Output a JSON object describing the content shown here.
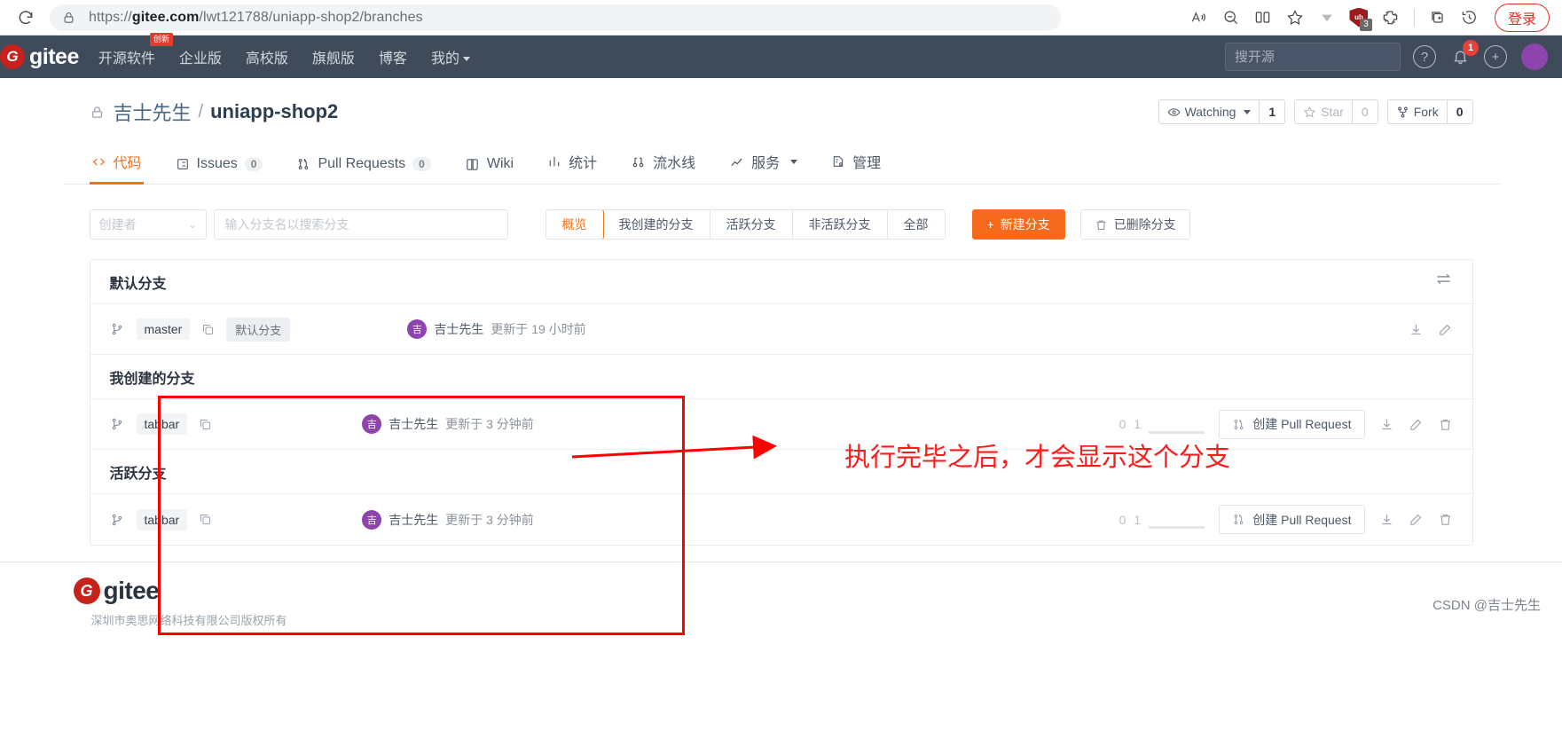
{
  "browser": {
    "reload_icon": "reload-icon",
    "lock_icon": "lock-icon",
    "url_prefix": "https://",
    "url_domain": "gitee.com",
    "url_path": "/lwt121788/uniapp-shop2/branches",
    "icons": [
      {
        "name": "read-aloud-icon",
        "glyph": "A"
      },
      {
        "name": "zoom-out-icon",
        "glyph": "search"
      },
      {
        "name": "split-screen-icon",
        "glyph": "split"
      },
      {
        "name": "favorite-star-icon",
        "glyph": "star"
      },
      {
        "name": "downloads-chevron-icon",
        "glyph": "V"
      },
      {
        "name": "shield-extension-icon",
        "glyph": "ub"
      },
      {
        "name": "puzzle-extension-icon",
        "glyph": "puzzle"
      },
      {
        "name": "collections-icon",
        "glyph": "collections"
      },
      {
        "name": "history-icon",
        "glyph": "history"
      }
    ],
    "shield_badge": "3",
    "login_label": "登录"
  },
  "navbar": {
    "logo": "gitee",
    "logo_mark": "G",
    "links": [
      {
        "label": "开源软件",
        "badge": "创新"
      },
      {
        "label": "企业版",
        "badge": ""
      },
      {
        "label": "高校版",
        "badge": ""
      },
      {
        "label": "旗舰版",
        "badge": ""
      },
      {
        "label": "博客",
        "badge": ""
      },
      {
        "label": "我的",
        "badge": "",
        "has_caret": true
      }
    ],
    "search_placeholder": "搜开源",
    "help_icon": "?",
    "notification_count": "1",
    "plus_icon": "+"
  },
  "repo": {
    "lock_icon": "lock-icon",
    "owner": "吉士先生",
    "separator": "/",
    "name": "uniapp-shop2",
    "watching_label": "Watching",
    "watching_count": "1",
    "star_label": "Star",
    "star_count": "0",
    "fork_label": "Fork",
    "fork_count": "0"
  },
  "tabs": [
    {
      "label": "代码",
      "count": "",
      "icon": "code-icon",
      "active": true
    },
    {
      "label": "Issues",
      "count": "0",
      "icon": "issues-icon",
      "active": false
    },
    {
      "label": "Pull Requests",
      "count": "0",
      "icon": "pull-request-icon",
      "active": false
    },
    {
      "label": "Wiki",
      "count": "",
      "icon": "book-icon",
      "active": false
    },
    {
      "label": "统计",
      "count": "",
      "icon": "chart-icon",
      "active": false
    },
    {
      "label": "流水线",
      "count": "",
      "icon": "pipeline-icon",
      "active": false
    },
    {
      "label": "服务",
      "count": "",
      "icon": "graph-icon",
      "active": false,
      "caret": true
    },
    {
      "label": "管理",
      "count": "",
      "icon": "settings-doc-icon",
      "active": false
    }
  ],
  "toolbar": {
    "creator_select": "创建者",
    "search_placeholder": "输入分支名以搜索分支",
    "filters": [
      {
        "label": "概览",
        "active": true
      },
      {
        "label": "我创建的分支",
        "active": false
      },
      {
        "label": "活跃分支",
        "active": false
      },
      {
        "label": "非活跃分支",
        "active": false
      },
      {
        "label": "全部",
        "active": false
      }
    ],
    "new_branch_label": "新建分支",
    "new_branch_plus": "+",
    "deleted_branch_label": "已删除分支"
  },
  "panels": [
    {
      "title": "默认分支",
      "has_swap": true,
      "rows": [
        {
          "branch": "master",
          "tag": "默认分支",
          "avatar_letter": "吉",
          "author": "吉士先生",
          "update_text": "更新于 19 小时前",
          "ahead": "",
          "behind": "",
          "pr_label": "",
          "show_pr": false,
          "show_trash": false
        }
      ]
    },
    {
      "title": "我创建的分支",
      "has_swap": false,
      "rows": [
        {
          "branch": "tabbar",
          "tag": "",
          "avatar_letter": "吉",
          "author": "吉士先生",
          "update_text": "更新于 3 分钟前",
          "ahead": "0",
          "behind": "1",
          "pr_label": "创建 Pull Request",
          "show_pr": true,
          "show_trash": true
        }
      ]
    },
    {
      "title": "活跃分支",
      "has_swap": false,
      "rows": [
        {
          "branch": "tabbar",
          "tag": "",
          "avatar_letter": "吉",
          "author": "吉士先生",
          "update_text": "更新于 3 分钟前",
          "ahead": "0",
          "behind": "1",
          "pr_label": "创建 Pull Request",
          "show_pr": true,
          "show_trash": true
        }
      ]
    }
  ],
  "row_icons": {
    "branch_icon": "branch-icon",
    "copy_icon": "copy-icon",
    "download_icon": "download-icon",
    "edit_icon": "edit-icon",
    "trash_icon": "trash-icon"
  },
  "annotation": {
    "text": "执行完毕之后，才会显示这个分支",
    "color": "#ff0000"
  },
  "footer": {
    "logo": "gitee",
    "logo_mark": "G",
    "sub_text": "深圳市奥思网络科技有限公司版权所有",
    "watermark": "CSDN @吉士先生"
  },
  "colors": {
    "accent": "#f0731c",
    "navbar_bg": "#3f4a5a",
    "annotation": "#ff0000",
    "avatar": "#8e44ad"
  }
}
